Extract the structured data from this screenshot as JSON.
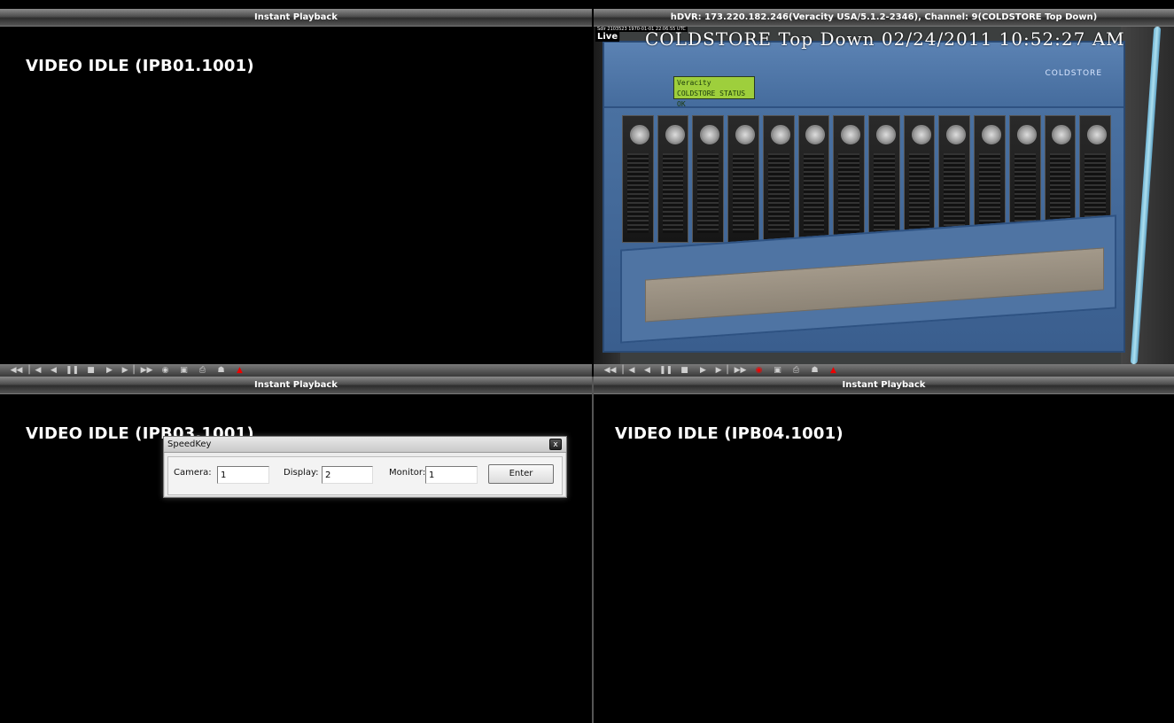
{
  "panes": {
    "top_left": {
      "title": "Instant Playback",
      "idle_text": "VIDEO IDLE (IPB01.1001)"
    },
    "top_right": {
      "title": "hDVR: 173.220.182.246(Veracity USA/5.1.2-2346), Channel: 9(COLDSTORE Top Down)",
      "osd_text": "COLDSTORE Top Down   02/24/2011 10:52:27 AM",
      "osd_small": "Sdlr 2103523 1970-01-01 22:06:55 UTC",
      "live_label": "Live",
      "lcd_text": "Veracity COLDSTORE\nSTATUS OK",
      "brand": "COLDSTORE"
    },
    "bottom_left": {
      "title": "Instant Playback",
      "idle_text": "VIDEO IDLE (IPB03.1001)"
    },
    "bottom_right": {
      "title": "Instant Playback",
      "idle_text": "VIDEO IDLE (IPB04.1001)"
    }
  },
  "controls": {
    "left": [
      {
        "name": "rewind-icon",
        "glyph": "◀◀"
      },
      {
        "name": "skip-start-icon",
        "glyph": "▏◀"
      },
      {
        "name": "step-back-icon",
        "glyph": "◀"
      },
      {
        "name": "pause-icon",
        "glyph": "❚❚"
      },
      {
        "name": "stop-icon",
        "glyph": "■"
      },
      {
        "name": "play-icon",
        "glyph": "▶"
      },
      {
        "name": "skip-end-icon",
        "glyph": "▶▕"
      },
      {
        "name": "fast-forward-icon",
        "glyph": "▶▶"
      },
      {
        "name": "eye-icon",
        "glyph": "◉"
      },
      {
        "name": "snapshot-icon",
        "glyph": "▣"
      },
      {
        "name": "print-icon",
        "glyph": "⎙"
      },
      {
        "name": "turtle-icon",
        "glyph": "☗"
      },
      {
        "name": "record-icon",
        "glyph": "▲",
        "red": true
      }
    ],
    "right": [
      {
        "name": "rewind-icon",
        "glyph": "◀◀"
      },
      {
        "name": "skip-start-icon",
        "glyph": "▏◀"
      },
      {
        "name": "step-back-icon",
        "glyph": "◀"
      },
      {
        "name": "pause-icon",
        "glyph": "❚❚"
      },
      {
        "name": "stop-icon",
        "glyph": "■"
      },
      {
        "name": "play-icon",
        "glyph": "▶"
      },
      {
        "name": "skip-end-icon",
        "glyph": "▶▕"
      },
      {
        "name": "fast-forward-icon",
        "glyph": "▶▶"
      },
      {
        "name": "eye-icon",
        "glyph": "◉",
        "red": true
      },
      {
        "name": "snapshot-icon",
        "glyph": "▣"
      },
      {
        "name": "print-icon",
        "glyph": "⎙"
      },
      {
        "name": "turtle-icon",
        "glyph": "☗"
      },
      {
        "name": "record-icon",
        "glyph": "▲",
        "red": true
      }
    ]
  },
  "speedkey": {
    "title": "SpeedKey",
    "close_label": "x",
    "camera_label": "Camera:",
    "camera_value": "1",
    "display_label": "Display:",
    "display_value": "2",
    "monitor_label": "Monitor:",
    "monitor_value": "1",
    "enter_label": "Enter"
  },
  "colors": {
    "record_red": "#e00000",
    "dvr_chassis_blue": "#4e76a6"
  }
}
